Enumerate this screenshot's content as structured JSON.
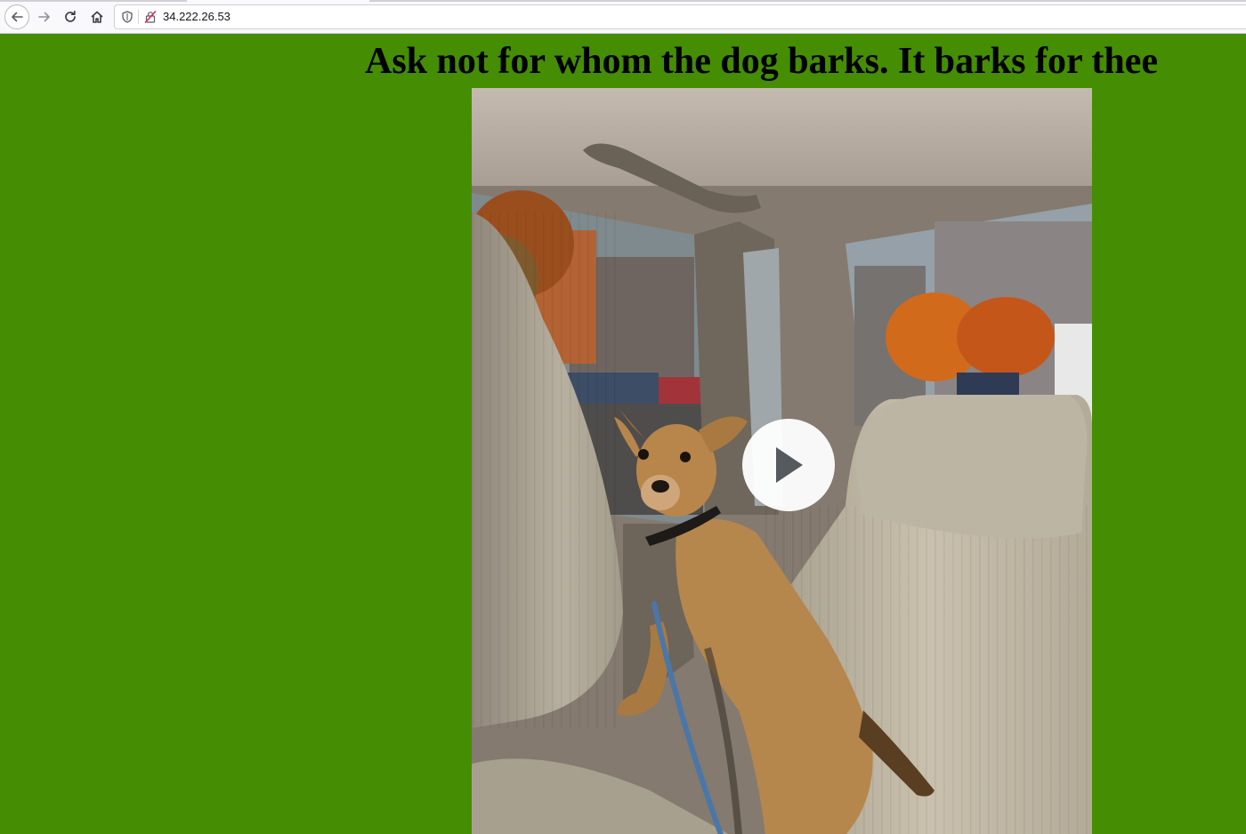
{
  "browser": {
    "url": "34.222.26.53",
    "back_icon": "arrow-left-icon",
    "forward_icon": "arrow-right-icon",
    "reload_icon": "reload-icon",
    "home_icon": "home-icon",
    "tracking_icon": "shield-icon",
    "insecure_icon": "insecure-lock-icon"
  },
  "page": {
    "heading": "Ask not for whom the dog barks. It barks for thee",
    "background_color": "#458d03",
    "video": {
      "play_icon": "play-icon"
    }
  }
}
